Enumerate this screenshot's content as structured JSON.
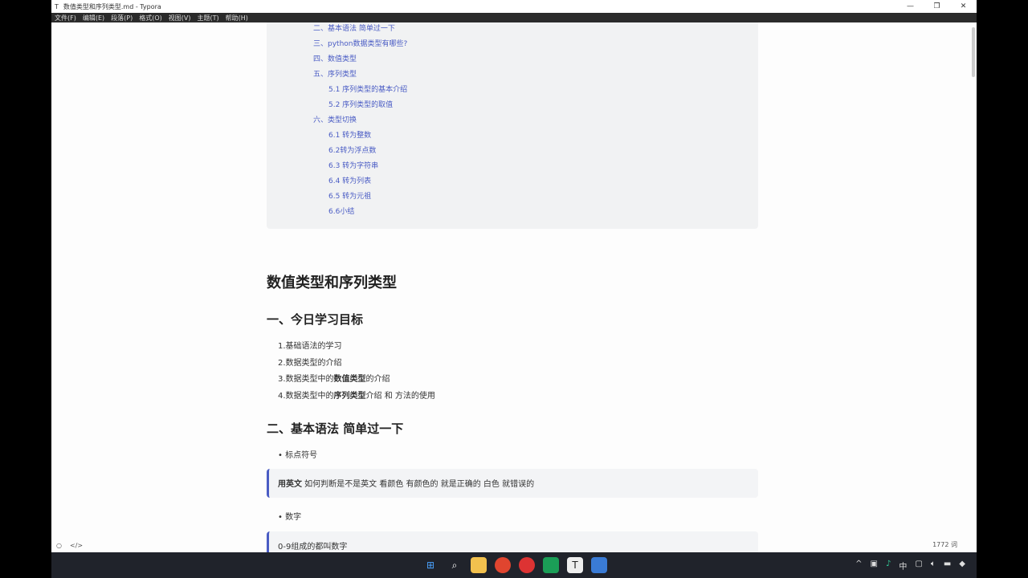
{
  "window": {
    "title": "数值类型和序列类型.md - Typora",
    "app_icon": "T",
    "controls": [
      "—",
      "❐",
      "✕"
    ]
  },
  "menu": [
    "文件(F)",
    "编辑(E)",
    "段落(P)",
    "格式(O)",
    "视图(V)",
    "主题(T)",
    "帮助(H)"
  ],
  "toc": [
    {
      "label": "二、基本语法  简单过一下",
      "level": 1
    },
    {
      "label": "三、python数据类型有哪些?",
      "level": 1
    },
    {
      "label": "四、数值类型",
      "level": 1
    },
    {
      "label": "五、序列类型",
      "level": 1
    },
    {
      "label": "5.1 序列类型的基本介绍",
      "level": 2
    },
    {
      "label": "5.2 序列类型的取值",
      "level": 2
    },
    {
      "label": "六、类型切换",
      "level": 1
    },
    {
      "label": "6.1 转为整数",
      "level": 2
    },
    {
      "label": "6.2转为浮点数",
      "level": 2
    },
    {
      "label": "6.3 转为字符串",
      "level": 2
    },
    {
      "label": "6.4 转为列表",
      "level": 2
    },
    {
      "label": "6.5 转为元祖",
      "level": 2
    },
    {
      "label": "6.6小结",
      "level": 2
    }
  ],
  "doc": {
    "h1": "数值类型和序列类型",
    "s1": {
      "title": "一、今日学习目标",
      "items": [
        {
          "pre": "1.基础语法的学习",
          "bold": "",
          "post": ""
        },
        {
          "pre": "2.数据类型的介绍",
          "bold": "",
          "post": ""
        },
        {
          "pre": "3.数据类型中的",
          "bold": "数值类型",
          "post": "的介绍"
        },
        {
          "pre": "4.数据类型中的",
          "bold": "序列类型",
          "post": "介绍 和 方法的使用"
        }
      ]
    },
    "s2": {
      "title": "二、基本语法  简单过一下",
      "bullet1": "标点符号",
      "quote1_bold": "用英文",
      "quote1": " 如何判断是不是英文 看颜色 有颜色的 就是正确的  白色 就错误的",
      "bullet2": "数字",
      "quote2": "0-9组成的都叫数字"
    }
  },
  "status": {
    "word_count": "1772 词"
  },
  "tray": {
    "ime": "中"
  }
}
